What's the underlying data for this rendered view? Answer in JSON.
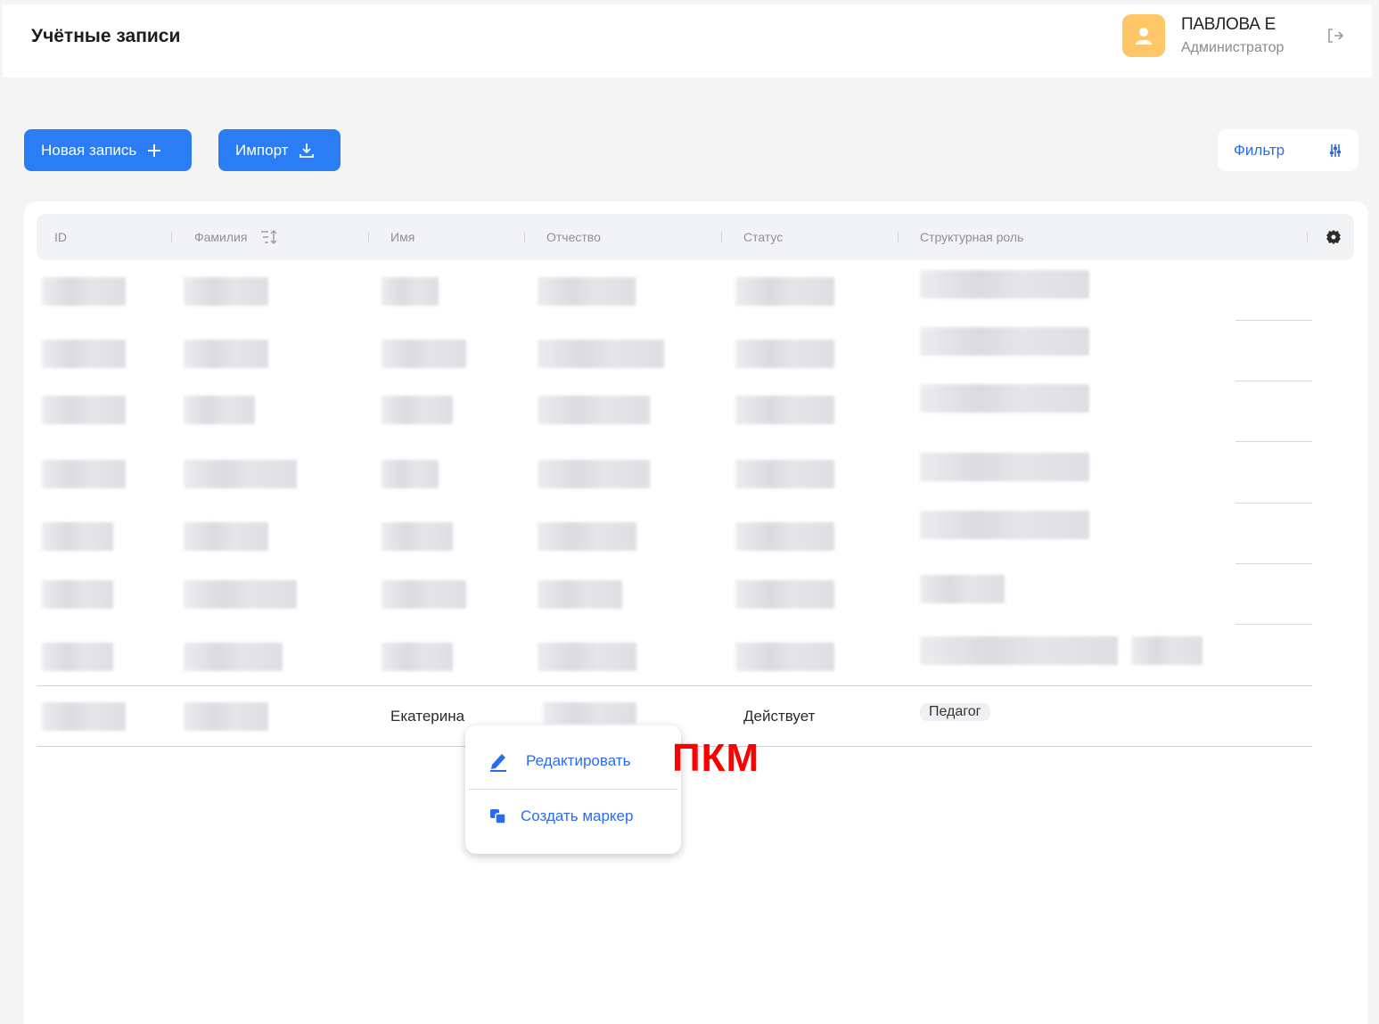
{
  "header": {
    "title": "Учётные записи",
    "user_name": "ПАВЛОВА Е",
    "user_role": "Администратор"
  },
  "toolbar": {
    "new_record_label": "Новая запись",
    "import_label": "Импорт",
    "filter_label": "Фильтр"
  },
  "table": {
    "columns": [
      "ID",
      "Фамилия",
      "Имя",
      "Отчество",
      "Статус",
      "Структурная роль"
    ],
    "highlighted_row": {
      "first_name": "Екатерина",
      "status": "Действует",
      "role": "Педагог"
    }
  },
  "context_menu": {
    "items": [
      {
        "label": "Редактировать",
        "icon": "pencil-icon"
      },
      {
        "label": "Создать маркер",
        "icon": "marker-icon"
      }
    ]
  },
  "annotation": {
    "label": "ПКМ"
  },
  "colors": {
    "accent": "#2a7df4",
    "link": "#2a6cf0",
    "avatar": "#ffc667",
    "annotation": "#ff0000"
  }
}
